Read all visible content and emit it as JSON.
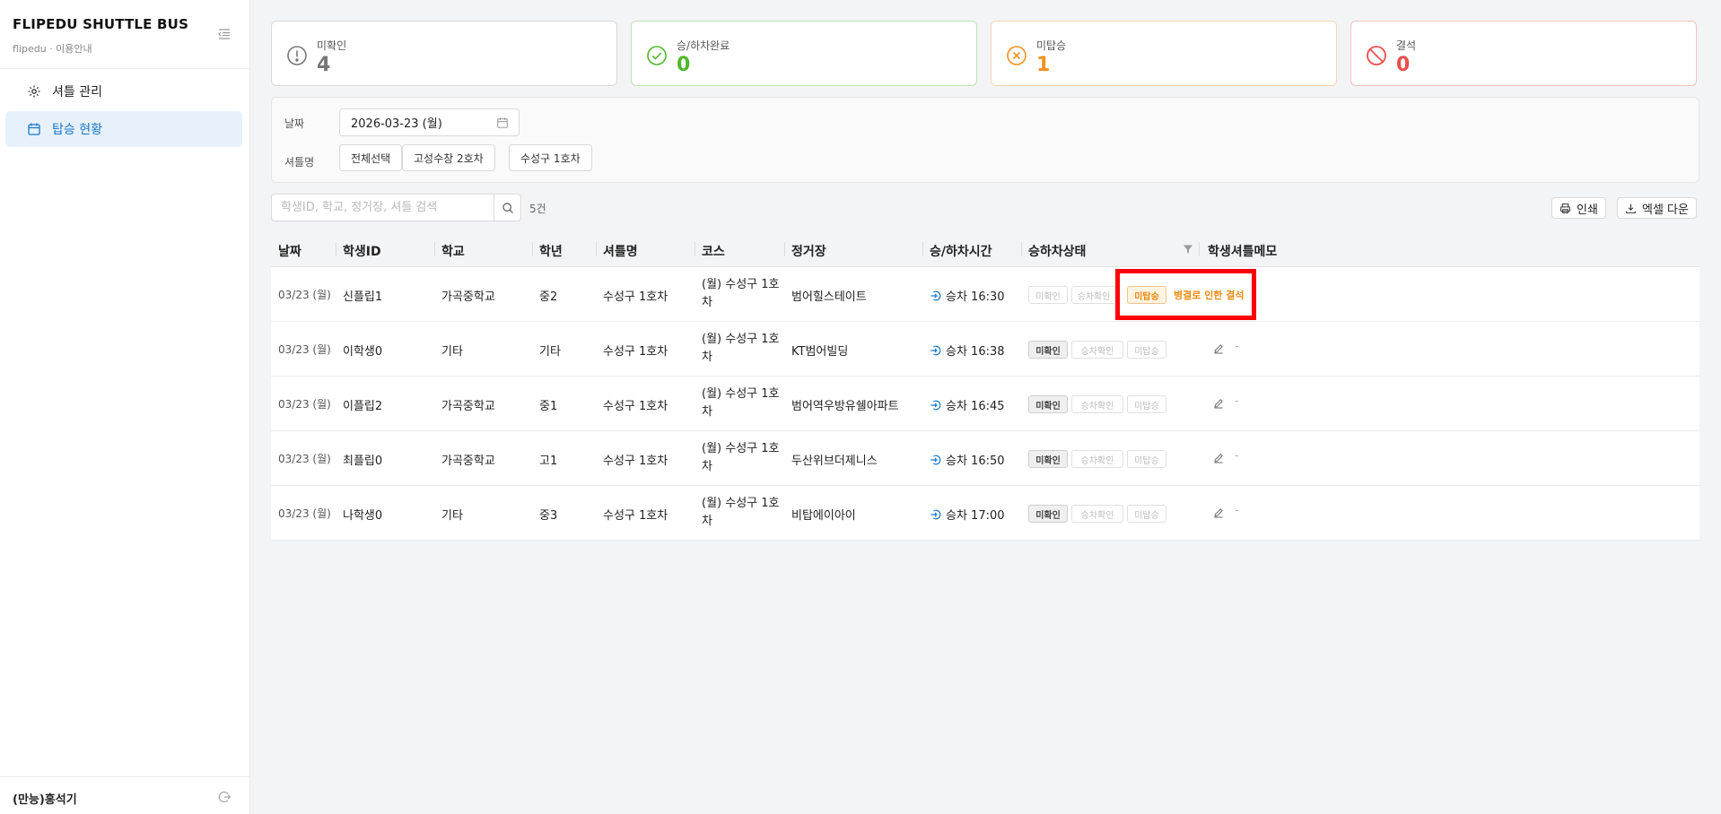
{
  "app": {
    "title": "FLIPEDU SHUTTLE BUS",
    "subtitle": "flipedu · 이용안내"
  },
  "sidebar": {
    "items": [
      {
        "label": "셔틀 관리",
        "icon": "gear-icon",
        "active": false
      },
      {
        "label": "탑승 현황",
        "icon": "calendar-icon",
        "active": true
      }
    ],
    "user": "(만능)홍석기"
  },
  "summary": [
    {
      "label": "미확인",
      "value": "4",
      "color": "#777777",
      "icon": "alert-circle-icon"
    },
    {
      "label": "승/하차완료",
      "value": "0",
      "color": "#52b72d",
      "icon": "check-circle-icon"
    },
    {
      "label": "미탑승",
      "value": "1",
      "color": "#f0911d",
      "icon": "x-circle-icon"
    },
    {
      "label": "결석",
      "value": "0",
      "color": "#ea4d4d",
      "icon": "block-icon"
    }
  ],
  "filter": {
    "date_label": "날짜",
    "date_value": "2026-03-23 (월)",
    "shuttle_label": "셔틀명",
    "chips": [
      "전체선택",
      "고성수창 2호차",
      "수성구 1호차"
    ]
  },
  "search": {
    "placeholder": "학생ID, 학교, 정거장, 셔틀 검색",
    "count": "5건"
  },
  "toolbar": {
    "print": "인쇄",
    "excel": "엑셀 다운"
  },
  "table": {
    "headers": [
      "날짜",
      "학생ID",
      "학교",
      "학년",
      "셔틀명",
      "코스",
      "정거장",
      "승/하차시간",
      "승하차상태",
      "학생셔틀메모"
    ],
    "status_buttons": [
      "미확인",
      "승차확인",
      "미탑승"
    ],
    "rows": [
      {
        "date": "03/23 (월)",
        "sid": "신플립1",
        "school": "가곡중학교",
        "grade": "중2",
        "shuttle": "수성구 1호차",
        "course": "(월) 수성구 1호차",
        "stop": "범어힐스테이트",
        "time": "승차 16:30",
        "status": "미탑승",
        "reason": "병결로 인한 결석",
        "memo": ""
      },
      {
        "date": "03/23 (월)",
        "sid": "이학생0",
        "school": "기타",
        "grade": "기타",
        "shuttle": "수성구 1호차",
        "course": "(월) 수성구 1호차",
        "stop": "KT범어빌딩",
        "time": "승차 16:38",
        "status": "미확인",
        "reason": "",
        "memo": "-"
      },
      {
        "date": "03/23 (월)",
        "sid": "이플립2",
        "school": "가곡중학교",
        "grade": "중1",
        "shuttle": "수성구 1호차",
        "course": "(월) 수성구 1호차",
        "stop": "범어역우방유쉘아파트",
        "time": "승차 16:45",
        "status": "미확인",
        "reason": "",
        "memo": "-"
      },
      {
        "date": "03/23 (월)",
        "sid": "최플립0",
        "school": "가곡중학교",
        "grade": "고1",
        "shuttle": "수성구 1호차",
        "course": "(월) 수성구 1호차",
        "stop": "두산위브더제니스",
        "time": "승차 16:50",
        "status": "미확인",
        "reason": "",
        "memo": "-"
      },
      {
        "date": "03/23 (월)",
        "sid": "나학생0",
        "school": "기타",
        "grade": "중3",
        "shuttle": "수성구 1호차",
        "course": "(월) 수성구 1호차",
        "stop": "비탑에이아이",
        "time": "승차 17:00",
        "status": "미확인",
        "reason": "",
        "memo": "-"
      }
    ]
  }
}
